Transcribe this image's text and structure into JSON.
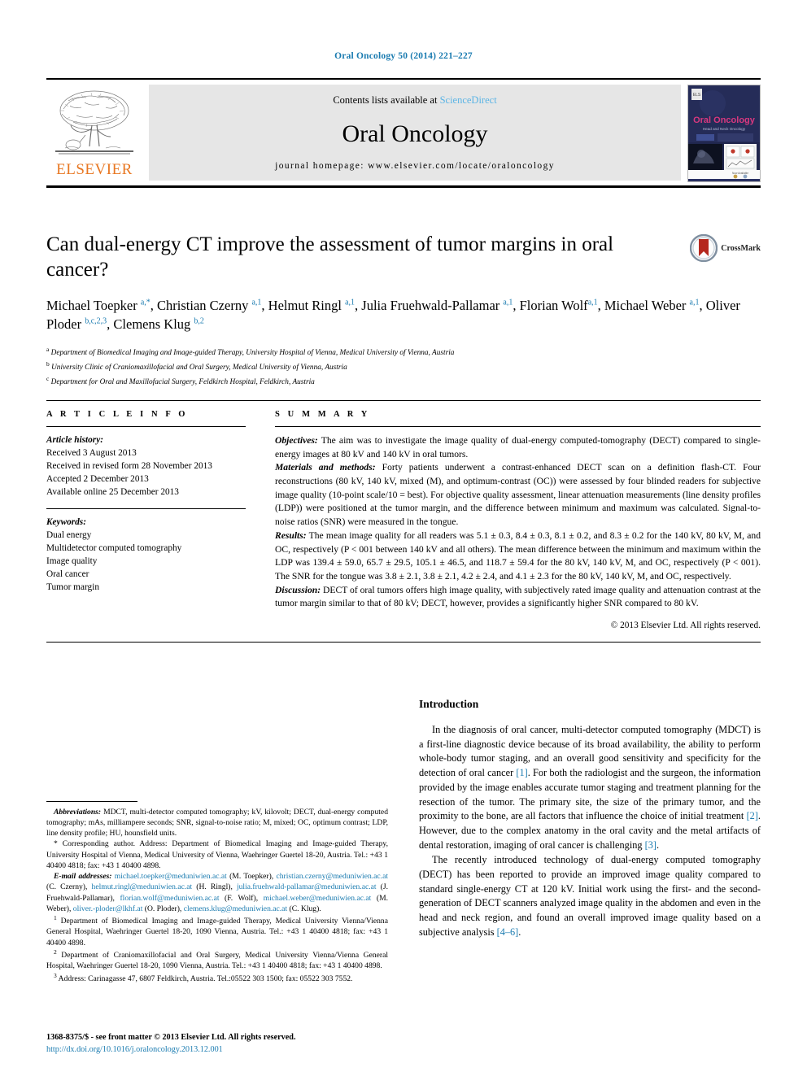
{
  "running_head": "Oral Oncology 50 (2014) 221–227",
  "masthead": {
    "contents_prefix": "Contents lists available at ",
    "sciencedirect": "ScienceDirect",
    "journal_title": "Oral Oncology",
    "homepage": "journal homepage: www.elsevier.com/locate/oraloncology",
    "publisher": "ELSEVIER",
    "cover_title": "Oral Oncology",
    "cover_subtitle": "Head and Neck Oncology",
    "link_color": "#5ab4e5",
    "publisher_color": "#E87722"
  },
  "article": {
    "title": "Can dual-energy CT improve the assessment of tumor margins in oral cancer?",
    "crossmark_label": "CrossMark",
    "authors_html": "Michael Toepker <sup>a,*</sup>, Christian Czerny <sup>a,1</sup>, Helmut Ringl <sup>a,1</sup>, Julia Fruehwald-Pallamar <sup>a,1</sup>, Florian Wolf<sup>a,1</sup>, Michael Weber <sup>a,1</sup>, Oliver Ploder <sup>b,c,2,3</sup>, Clemens Klug <sup>b,2</sup>",
    "affiliations": [
      {
        "marker": "a",
        "text": "Department of Biomedical Imaging and Image-guided Therapy, University Hospital of Vienna, Medical University of Vienna, Austria"
      },
      {
        "marker": "b",
        "text": "University Clinic of Craniomaxillofacial and Oral Surgery, Medical University of Vienna, Austria"
      },
      {
        "marker": "c",
        "text": "Department for Oral and Maxillofacial Surgery, Feldkirch Hospital, Feldkirch, Austria"
      }
    ]
  },
  "article_info": {
    "heading": "A R T I C L E   I N F O",
    "history_label": "Article history:",
    "history": [
      "Received 3 August 2013",
      "Received in revised form 28 November 2013",
      "Accepted 2 December 2013",
      "Available online 25 December 2013"
    ],
    "keywords_label": "Keywords:",
    "keywords": [
      "Dual energy",
      "Multidetector computed tomography",
      "Image quality",
      "Oral cancer",
      "Tumor margin"
    ]
  },
  "summary": {
    "heading": "S U M M A R Y",
    "objectives_label": "Objectives:",
    "objectives_text": " The aim was to investigate the image quality of dual-energy computed-tomography (DECT) compared to single-energy images at 80 kV and 140 kV in oral tumors.",
    "methods_label": "Materials and methods:",
    "methods_text": " Forty patients underwent a contrast-enhanced DECT scan on a definition flash-CT. Four reconstructions (80 kV, 140 kV, mixed (M), and optimum-contrast (OC)) were assessed by four blinded readers for subjective image quality (10-point scale/10 = best). For objective quality assessment, linear attenuation measurements (line density profiles (LDP)) were positioned at the tumor margin, and the difference between minimum and maximum was calculated. Signal-to-noise ratios (SNR) were measured in the tongue.",
    "results_label": "Results:",
    "results_text": " The mean image quality for all readers was 5.1 ± 0.3, 8.4 ± 0.3, 8.1 ± 0.2, and 8.3 ± 0.2 for the 140 kV, 80 kV, M, and OC, respectively (P < 001 between 140 kV and all others). The mean difference between the minimum and maximum within the LDP was 139.4 ± 59.0, 65.7 ± 29.5, 105.1 ± 46.5, and 118.7 ± 59.4 for the 80 kV, 140 kV, M, and OC, respectively (P < 001). The SNR for the tongue was 3.8 ± 2.1, 3.8 ± 2.1, 4.2 ± 2.4, and 4.1 ± 2.3 for the 80 kV, 140 kV, M, and OC, respectively.",
    "discussion_label": "Discussion:",
    "discussion_text": " DECT of oral tumors offers high image quality, with subjectively rated image quality and attenuation contrast at the tumor margin similar to that of 80 kV; DECT, however, provides a significantly higher SNR compared to 80 kV.",
    "copyright": "© 2013 Elsevier Ltd. All rights reserved."
  },
  "notes": {
    "abbreviations_label": "Abbreviations:",
    "abbreviations_text": " MDCT, multi-detector computed tomography; kV, kilovolt; DECT, dual-energy computed tomography; mAs, milliampere seconds; SNR, signal-to-noise ratio; M, mixed; OC, optimum contrast; LDP, line density profile; HU, hounsfield units.",
    "corresponding": "* Corresponding author. Address: Department of Biomedical Imaging and Image-guided Therapy, University Hospital of Vienna, Medical University of Vienna, Waehringer Guertel 18-20, Austria. Tel.: +43 1 40400 4818; fax: +43 1 40400 4898.",
    "email_label": "E-mail addresses:",
    "emails": [
      {
        "address": "michael.toepker@meduniwien.ac.at",
        "person": " (M. Toepker), "
      },
      {
        "address": "christian.czerny@meduniwien.ac.at",
        "person": " (C. Czerny), "
      },
      {
        "address": "helmut.ringl@meduniwien.ac.at",
        "person": " (H. Ringl), "
      },
      {
        "address": "julia.fruehwald-pallamar@meduniwien.ac.at",
        "person": " (J. Fruehwald-Pallamar), "
      },
      {
        "address": "florian.wolf@meduniwien.ac.at",
        "person": " (F. Wolf), "
      },
      {
        "address": "michael.weber@meduniwien.ac.at",
        "person": " (M. Weber), "
      },
      {
        "address": "oliver.-ploder@lkhf.at",
        "person": " (O. Ploder), "
      },
      {
        "address": "clemens.klug@meduniwien.ac.at",
        "person": " (C. Klug)."
      }
    ],
    "footnote1": "Department of Biomedical Imaging and Image-guided Therapy, Medical University Vienna/Vienna General Hospital, Waehringer Guertel 18-20, 1090 Vienna, Austria. Tel.: +43 1 40400 4818; fax: +43 1 40400 4898.",
    "footnote2": "Department of Craniomaxillofacial and Oral Surgery, Medical University Vienna/Vienna General Hospital, Waehringer Guertel 18-20, 1090 Vienna, Austria. Tel.: +43 1 40400 4818; fax: +43 1 40400 4898.",
    "footnote3": "Address: Carinagasse 47, 6807 Feldkirch, Austria. Tel.:05522 303 1500; fax: 05522 303 7552."
  },
  "footer": {
    "issn_line": "1368-8375/$ - see front matter © 2013 Elsevier Ltd. All rights reserved.",
    "doi": "http://dx.doi.org/10.1016/j.oraloncology.2013.12.001"
  },
  "introduction": {
    "heading": "Introduction",
    "paragraph1_a": "In the diagnosis of oral cancer, multi-detector computed tomography (MDCT) is a first-line diagnostic device because of its broad availability, the ability to perform whole-body tumor staging, and an overall good sensitivity and specificity for the detection of oral cancer ",
    "ref1": "[1]",
    "paragraph1_b": ". For both the radiologist and the surgeon, the information provided by the image enables accurate tumor staging and treatment planning for the resection of the tumor. The primary site, the size of the primary tumor, and the proximity to the bone, are all factors that influence the choice of initial treatment ",
    "ref2": "[2]",
    "paragraph1_c": ". However, due to the complex anatomy in the oral cavity and the metal artifacts of dental restoration, imaging of oral cancer is challenging ",
    "ref3": "[3]",
    "paragraph1_d": ".",
    "paragraph2_a": "The recently introduced technology of dual-energy computed tomography (DECT) has been reported to provide an improved image quality compared to standard single-energy CT at 120 kV. Initial work using the first- and the second-generation of DECT scanners analyzed image quality in the abdomen and even in the head and neck region, and found an overall improved image quality based on a subjective analysis ",
    "ref4": "[4–6]",
    "paragraph2_b": "."
  }
}
